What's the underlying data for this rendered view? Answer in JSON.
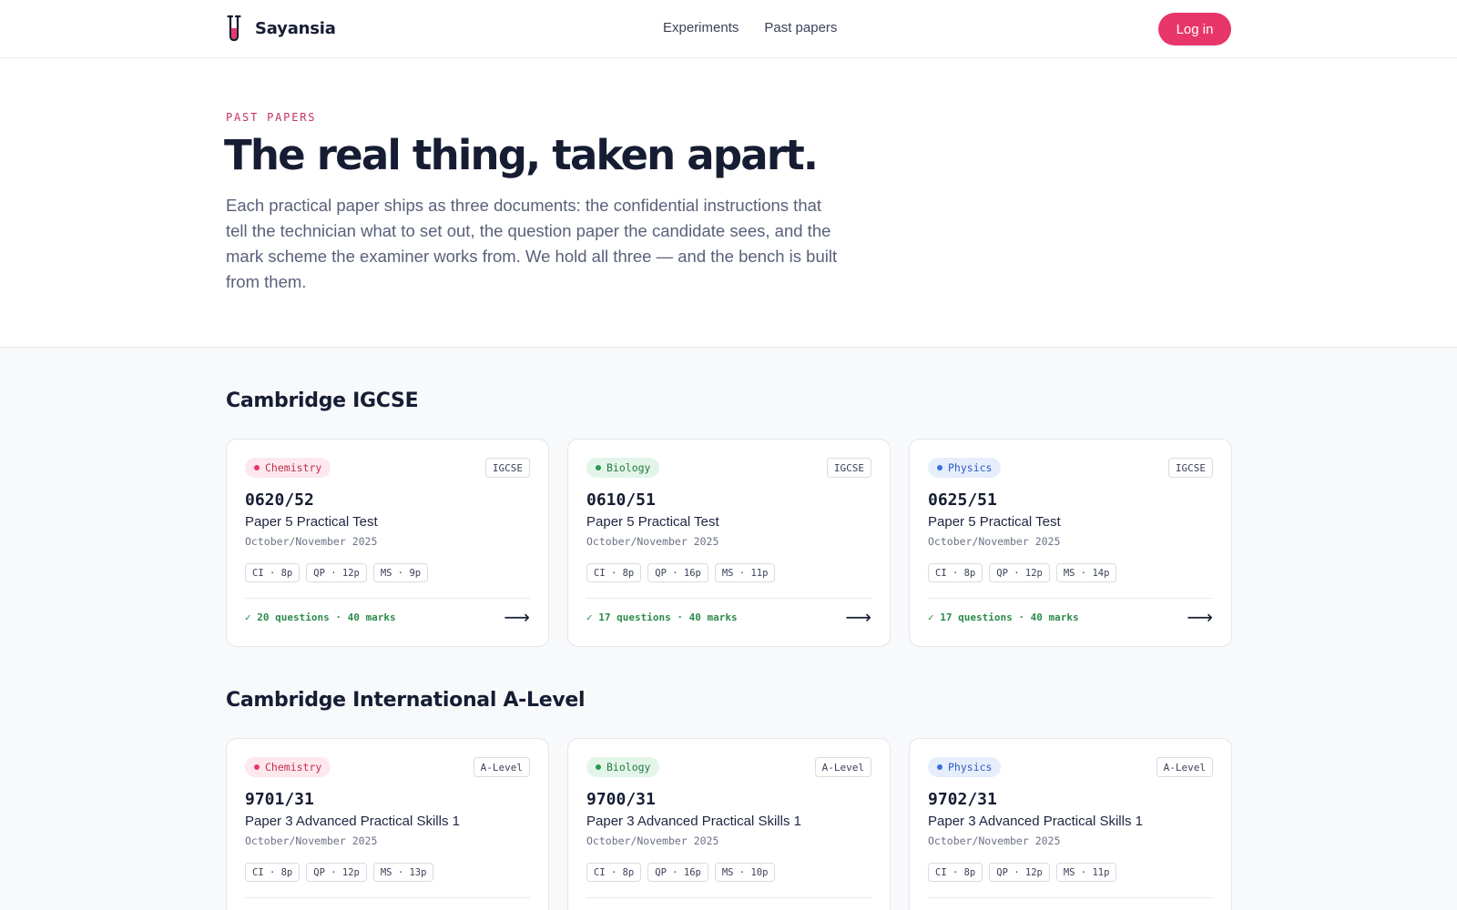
{
  "brand": {
    "name": "Sayansia",
    "logo_icon": "test-tube-icon",
    "accent": "#e8366a"
  },
  "nav": {
    "links": [
      "Experiments",
      "Past papers"
    ],
    "login_label": "Log in"
  },
  "hero": {
    "eyebrow": "PAST PAPERS",
    "title": "The real thing, taken apart.",
    "description": "Each practical paper ships as three documents: the confidential instructions that tell the technician what to set out, the question paper the candidate sees, and the mark scheme the examiner works from. We hold all three — and the bench is built from them."
  },
  "subject_colors": {
    "Chemistry": {
      "bg": "#fde8ee",
      "dot": "#e8366a",
      "text": "#c0304f"
    },
    "Biology": {
      "bg": "#e3f5e8",
      "dot": "#2c9a52",
      "text": "#237a44"
    },
    "Physics": {
      "bg": "#e6eefc",
      "dot": "#3a6fe0",
      "text": "#2f5bc4"
    }
  },
  "sections": [
    {
      "title": "Cambridge IGCSE",
      "cards": [
        {
          "subject": "Chemistry",
          "level": "IGCSE",
          "code": "0620/52",
          "name": "Paper 5 Practical Test",
          "session": "October/November 2025",
          "docs": [
            "CI · 8p",
            "QP · 12p",
            "MS · 9p"
          ],
          "stats": "✓ 20 questions · 40 marks",
          "arrow": "⟶"
        },
        {
          "subject": "Biology",
          "level": "IGCSE",
          "code": "0610/51",
          "name": "Paper 5 Practical Test",
          "session": "October/November 2025",
          "docs": [
            "CI · 8p",
            "QP · 16p",
            "MS · 11p"
          ],
          "stats": "✓ 17 questions · 40 marks",
          "arrow": "⟶"
        },
        {
          "subject": "Physics",
          "level": "IGCSE",
          "code": "0625/51",
          "name": "Paper 5 Practical Test",
          "session": "October/November 2025",
          "docs": [
            "CI · 8p",
            "QP · 12p",
            "MS · 14p"
          ],
          "stats": "✓ 17 questions · 40 marks",
          "arrow": "⟶"
        }
      ]
    },
    {
      "title": "Cambridge International A-Level",
      "cards": [
        {
          "subject": "Chemistry",
          "level": "A-Level",
          "code": "9701/31",
          "name": "Paper 3 Advanced Practical Skills 1",
          "session": "October/November 2025",
          "docs": [
            "CI · 8p",
            "QP · 12p",
            "MS · 13p"
          ],
          "stats": "",
          "arrow": ""
        },
        {
          "subject": "Biology",
          "level": "A-Level",
          "code": "9700/31",
          "name": "Paper 3 Advanced Practical Skills 1",
          "session": "October/November 2025",
          "docs": [
            "CI · 8p",
            "QP · 16p",
            "MS · 10p"
          ],
          "stats": "",
          "arrow": ""
        },
        {
          "subject": "Physics",
          "level": "A-Level",
          "code": "9702/31",
          "name": "Paper 3 Advanced Practical Skills 1",
          "session": "October/November 2025",
          "docs": [
            "CI · 8p",
            "QP · 12p",
            "MS · 11p"
          ],
          "stats": "",
          "arrow": ""
        }
      ]
    }
  ]
}
